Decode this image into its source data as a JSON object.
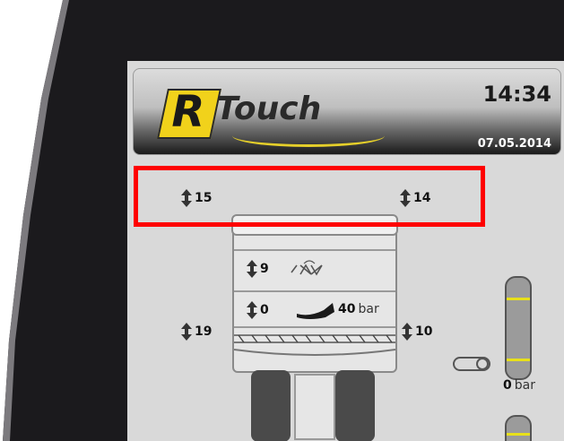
{
  "header": {
    "logo_letter": "R",
    "logo_text": "Touch",
    "time": "14:34",
    "date": "07.05.2014"
  },
  "readings": {
    "top_left": "15",
    "top_right": "14",
    "upper_section": "9",
    "lower_section": "0",
    "pressure_value": "40",
    "pressure_unit": "bar",
    "left_side": "19",
    "right_side": "10",
    "tank_value": "0",
    "tank_unit": "bar"
  },
  "colors": {
    "highlight": "#ff0000",
    "logo_yellow": "#f1d21b",
    "tank_mark": "#e8e01a"
  }
}
